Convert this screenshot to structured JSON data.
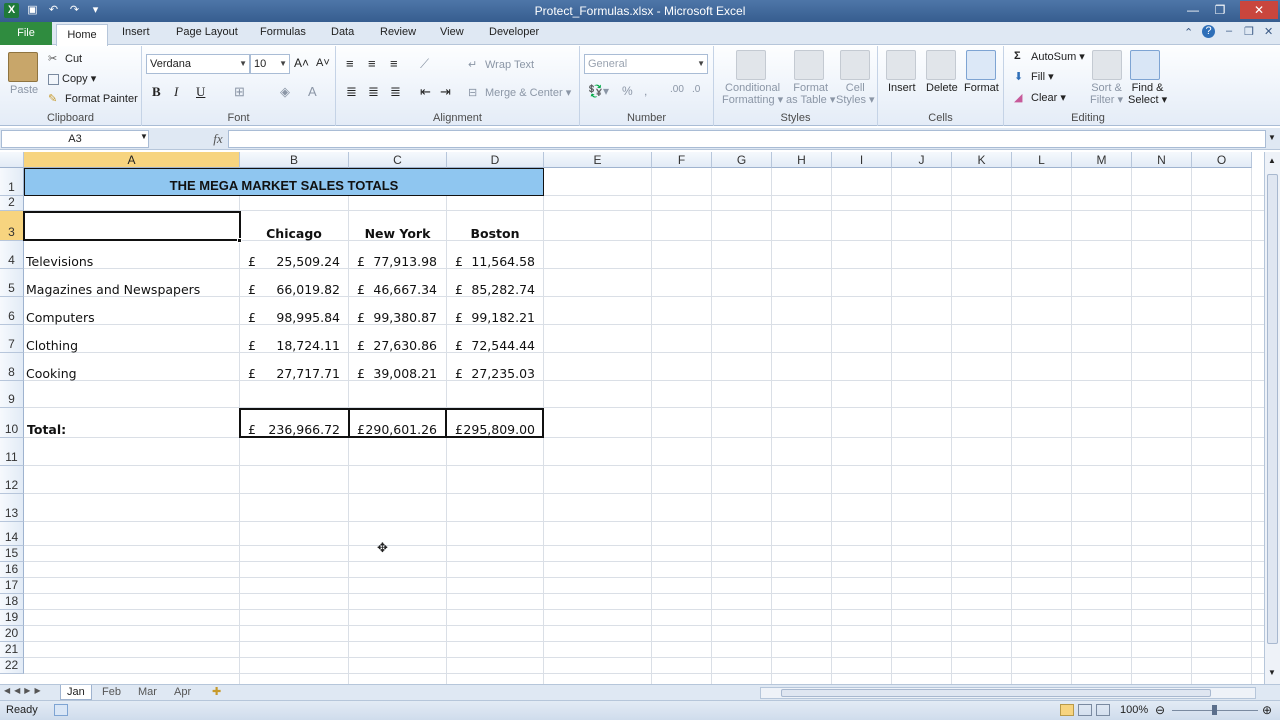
{
  "window": {
    "title": "Protect_Formulas.xlsx - Microsoft Excel",
    "minimize": "—",
    "restore": "❐",
    "close": "✕"
  },
  "ribbon_tabs": [
    "File",
    "Home",
    "Insert",
    "Page Layout",
    "Formulas",
    "Data",
    "Review",
    "View",
    "Developer"
  ],
  "ribbon": {
    "clipboard": {
      "paste": "Paste",
      "cut": "Cut",
      "copy": "Copy ▾",
      "format_painter": "Format Painter",
      "label": "Clipboard"
    },
    "font": {
      "name": "Verdana",
      "size": "10",
      "bold": "B",
      "italic": "I",
      "underline": "U",
      "label": "Font"
    },
    "alignment": {
      "wrap_text": "Wrap Text",
      "merge_center": "Merge & Center",
      "label": "Alignment"
    },
    "number": {
      "format": "General",
      "label": "Number"
    },
    "styles": {
      "conditional": "Conditional",
      "conditional2": "Formatting ▾",
      "format_as": "Format",
      "format_as2": "as Table ▾",
      "cell": "Cell",
      "cell2": "Styles ▾",
      "label": "Styles"
    },
    "cells": {
      "insert": "Insert",
      "delete": "Delete",
      "format": "Format",
      "label": "Cells"
    },
    "editing": {
      "autosum": "AutoSum ▾",
      "fill": "Fill ▾",
      "clear": "Clear ▾",
      "sort": "Sort &",
      "sort2": "Filter ▾",
      "find": "Find &",
      "find2": "Select ▾",
      "label": "Editing"
    }
  },
  "formula_bar": {
    "name_box": "A3",
    "fx": "fx",
    "formula": ""
  },
  "columns": [
    {
      "letter": "A",
      "selected": true
    },
    {
      "letter": "B"
    },
    {
      "letter": "C"
    },
    {
      "letter": "D"
    },
    {
      "letter": "E"
    },
    {
      "letter": "F"
    },
    {
      "letter": "G"
    },
    {
      "letter": "H"
    },
    {
      "letter": "I"
    },
    {
      "letter": "J"
    },
    {
      "letter": "K"
    },
    {
      "letter": "L"
    },
    {
      "letter": "M"
    },
    {
      "letter": "N"
    },
    {
      "letter": "O"
    }
  ],
  "rows": [
    "1",
    "2",
    "3",
    "4",
    "5",
    "6",
    "7",
    "8",
    "9",
    "10",
    "11",
    "12",
    "13",
    "14",
    "15",
    "16",
    "17",
    "18",
    "19",
    "20",
    "21",
    "22"
  ],
  "sheet": {
    "title": "THE MEGA MARKET SALES TOTALS",
    "headers": [
      "Chicago",
      "New York",
      "Boston"
    ],
    "currency": "£",
    "items": [
      {
        "label": "Televisions",
        "values": [
          "25,509.24",
          "77,913.98",
          "11,564.58"
        ]
      },
      {
        "label": "Magazines and Newspapers",
        "values": [
          "66,019.82",
          "46,667.34",
          "85,282.74"
        ]
      },
      {
        "label": "Computers",
        "values": [
          "98,995.84",
          "99,380.87",
          "99,182.21"
        ]
      },
      {
        "label": "Clothing",
        "values": [
          "18,724.11",
          "27,630.86",
          "72,544.44"
        ]
      },
      {
        "label": "Cooking",
        "values": [
          "27,717.71",
          "39,008.21",
          "27,235.03"
        ]
      }
    ],
    "total_label": "Total:",
    "totals": [
      "236,966.72",
      "290,601.26",
      "295,809.00"
    ]
  },
  "sheet_tabs": [
    {
      "name": "Jan",
      "active": true
    },
    {
      "name": "Feb"
    },
    {
      "name": "Mar"
    },
    {
      "name": "Apr"
    }
  ],
  "status": {
    "ready": "Ready",
    "zoom": "100%"
  }
}
